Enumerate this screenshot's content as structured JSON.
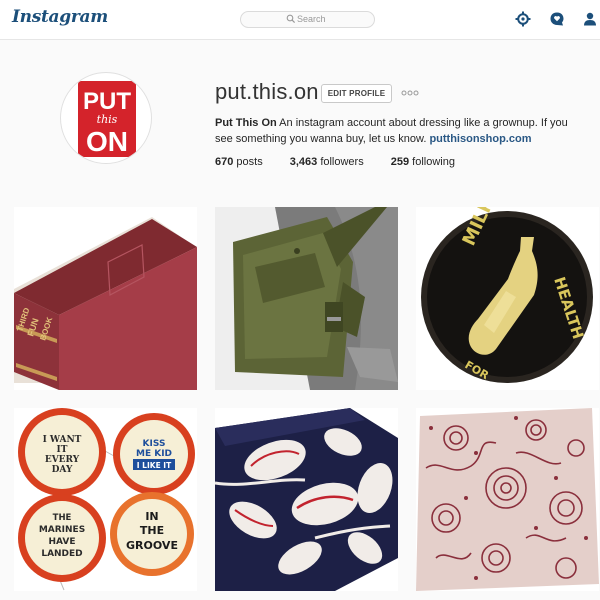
{
  "header": {
    "logo": "Instagram",
    "search_placeholder": "Search",
    "nav_icons": [
      "compass-icon",
      "activity-heart-icon",
      "profile-icon"
    ]
  },
  "profile": {
    "avatar_text": {
      "top": "PUT",
      "middle": "this",
      "bottom": "ON"
    },
    "username": "put.this.on",
    "edit_label": "EDIT PROFILE",
    "full_name": "Put This On",
    "bio": " An instagram account about dressing like a grownup. If you see something you wanna buy, let us know. ",
    "bio_link": "putthisonshop.com",
    "stats": [
      {
        "count": "670",
        "label": "posts"
      },
      {
        "count": "3,463",
        "label": "followers"
      },
      {
        "count": "259",
        "label": "following"
      }
    ]
  },
  "posts": [
    {
      "subject": "red-book",
      "spine_text": [
        "THIRD",
        "FUN",
        "BOOK"
      ]
    },
    {
      "subject": "green-backpack"
    },
    {
      "subject": "milk-health-button",
      "text": [
        "MILK",
        "FOR",
        "HEALTH"
      ]
    },
    {
      "subject": "vintage-pinback-buttons",
      "buttons": [
        [
          "I WANT",
          "IT",
          "EVERY",
          "DAY"
        ],
        [
          "KISS",
          "ME KID",
          "I LIKE IT"
        ],
        [
          "THE",
          "MARINES",
          "HAVE",
          "LANDED"
        ],
        [
          "IN",
          "THE",
          "GROOVE"
        ]
      ]
    },
    {
      "subject": "navy-floral-fabric"
    },
    {
      "subject": "pink-floral-bandana"
    }
  ],
  "colors": {
    "brand": "#1c4f7a",
    "link": "#2a5885",
    "avatar_red": "#d4232b"
  }
}
